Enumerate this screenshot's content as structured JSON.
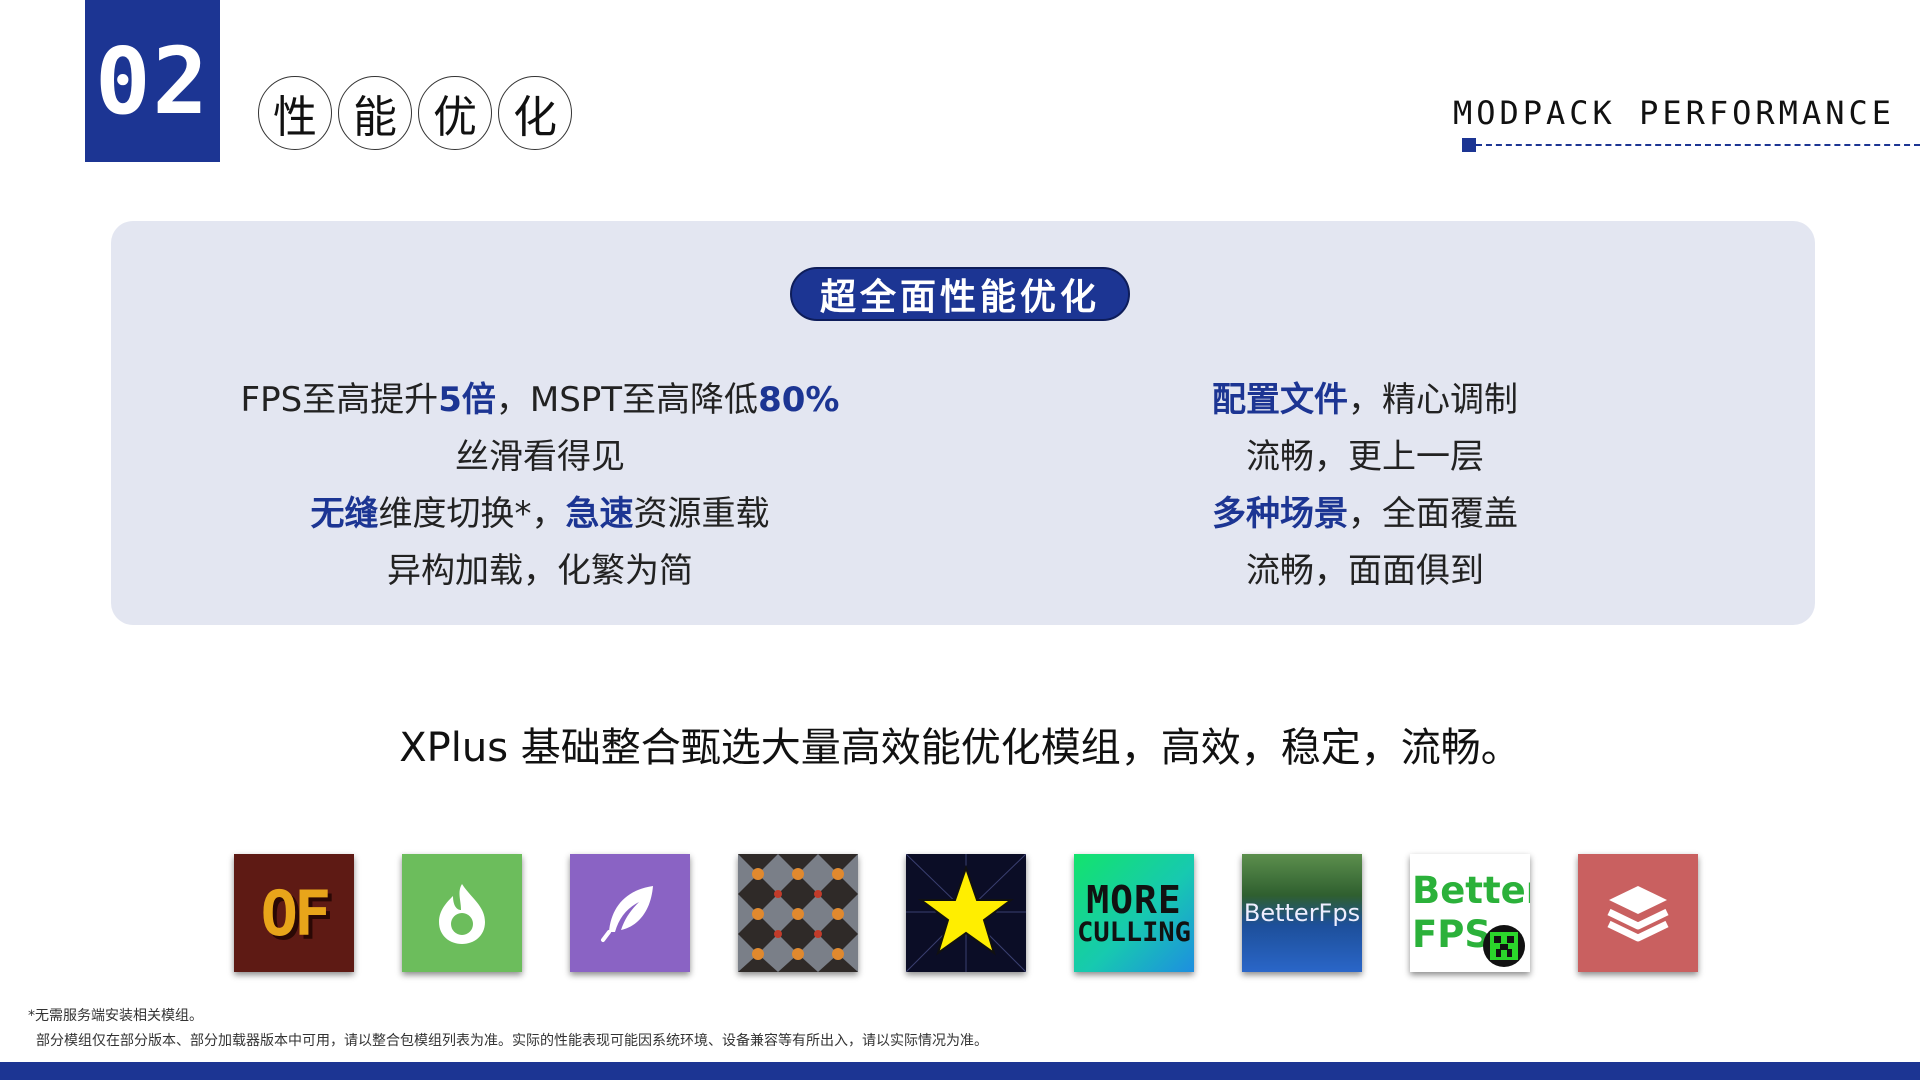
{
  "section_number": "02",
  "title_chars": [
    "性",
    "能",
    "优",
    "化"
  ],
  "subtitle_en": "MODPACK PERFORMANCE",
  "pill_title": "超全面性能优化",
  "left_lines": [
    {
      "a": "FPS至高提升",
      "b": "5倍",
      "c": "，MSPT至高降低",
      "d": "80%"
    },
    {
      "text": "丝滑看得见"
    },
    {
      "a": "无缝",
      "b": "维度切换*，",
      "c": "急速",
      "d": "资源重载"
    },
    {
      "text": "异构加载，化繁为简"
    }
  ],
  "right_lines": [
    {
      "hl": "配置文件",
      "rest": "，精心调制"
    },
    {
      "text": "流畅，更上一层"
    },
    {
      "hl": "多种场景",
      "rest": "，全面覆盖"
    },
    {
      "text": "流畅，面面俱到"
    }
  ],
  "tagline": "XPlus 基础整合甄选大量高效能优化模组，高效，稳定，流畅。",
  "icons": {
    "of": "OF",
    "moreculling_1": "MORE",
    "moreculling_2": "CULLING",
    "betterfps_img": "BetterFps",
    "betterfps_1": "Better",
    "betterfps_2": "FPS"
  },
  "footnote_1": "*无需服务端安装相关模组。",
  "footnote_2": "部分模组仅在部分版本、部分加载器版本中可用，请以整合包模组列表为准。实际的性能表现可能因系统环境、设备兼容等有所出入，请以实际情况为准。",
  "colors": {
    "accent": "#1c3593",
    "panel": "#e3e6f1"
  }
}
